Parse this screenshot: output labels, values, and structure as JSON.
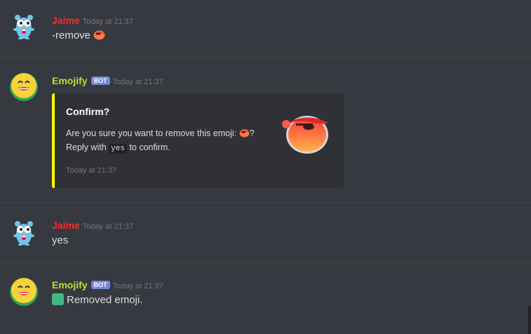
{
  "messages": [
    {
      "username": "Jaime",
      "username_color": "#ff2a2a",
      "timestamp": "Today at 21:37",
      "text": "-remove"
    },
    {
      "username": "Emojify",
      "username_color": "#bfe02a",
      "bot_badge": "BOT",
      "timestamp": "Today at 21:37",
      "embed": {
        "accent_color": "#fdff00",
        "title": "Confirm?",
        "line1": "Are you sure you want to remove this emoji:",
        "line1_end": "?",
        "line2_start": "Reply with",
        "code": "yes",
        "line2_end": "to confirm.",
        "footer": "Today at 21:37"
      }
    },
    {
      "username": "Jaime",
      "username_color": "#ff2a2a",
      "timestamp": "Today at 21:37",
      "text": "yes"
    },
    {
      "username": "Emojify",
      "username_color": "#bfe02a",
      "bot_badge": "BOT",
      "timestamp": "Today at 21:37",
      "text": "Removed emoji."
    }
  ],
  "icons": {
    "gopher_avatar": "gopher-avatar-icon",
    "bot_avatar": "smiley-avatar-icon",
    "emoji": "pirate-emoji-icon",
    "check": "check-square-icon"
  }
}
